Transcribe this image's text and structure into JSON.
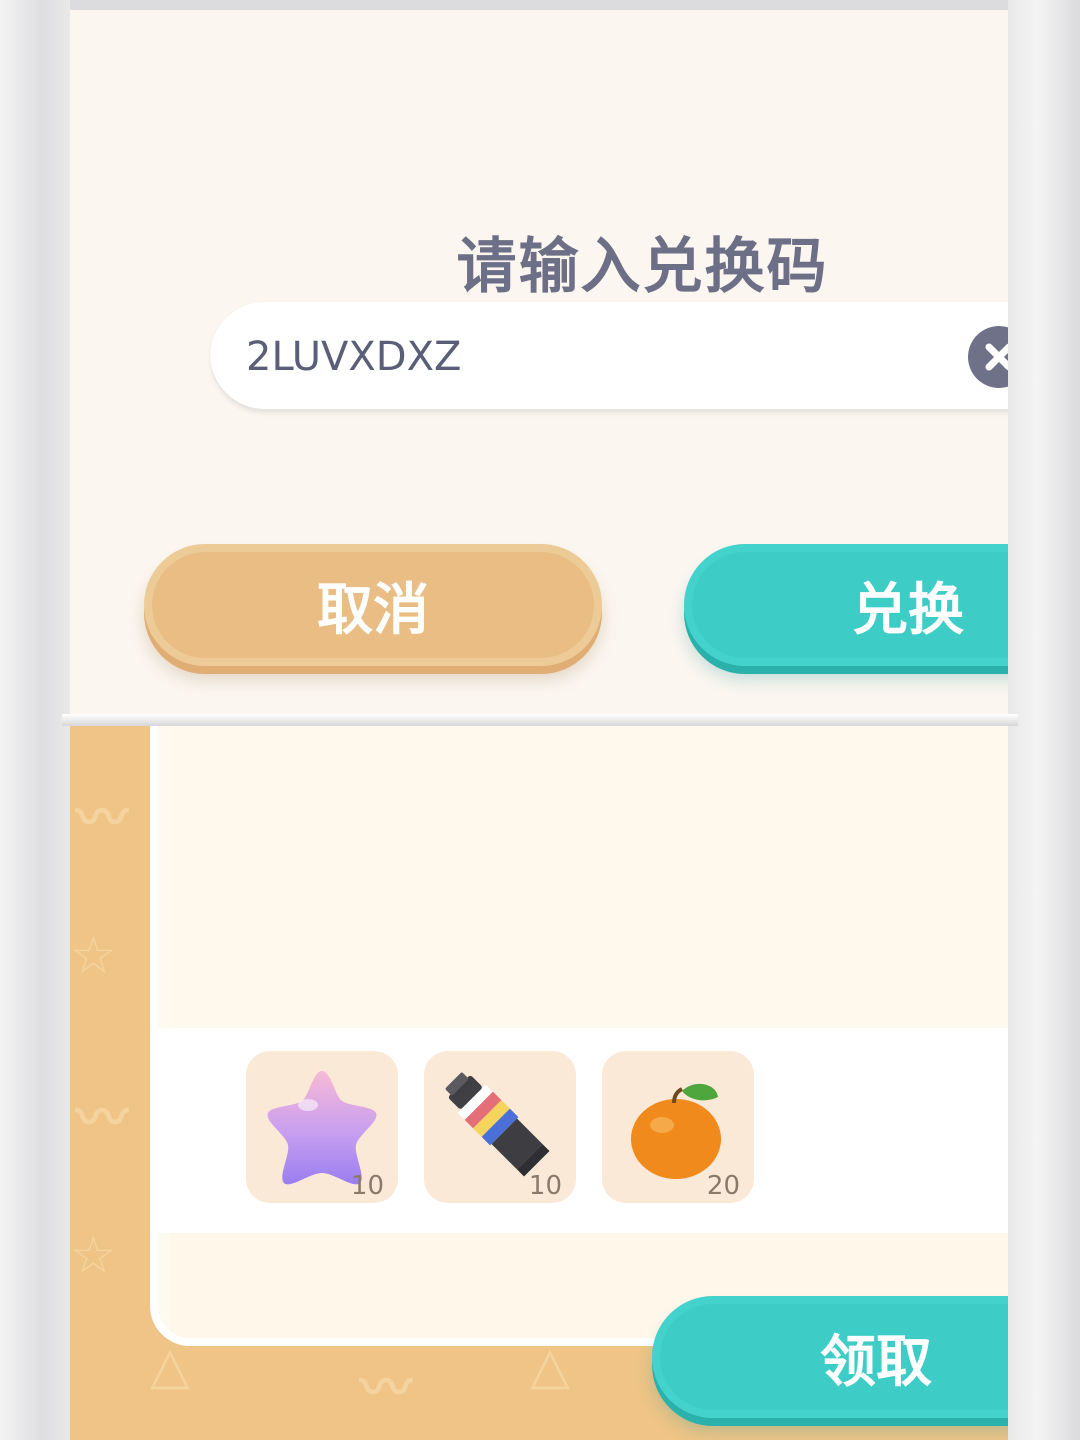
{
  "dialog": {
    "title": "请输入兑换码",
    "input_value": "2LUVXDXZ",
    "cancel_label": "取消",
    "redeem_label": "兑换"
  },
  "rewards": {
    "items": [
      {
        "icon": "star-icon",
        "count": "10"
      },
      {
        "icon": "paint-tube-icon",
        "count": "10"
      },
      {
        "icon": "orange-icon",
        "count": "20"
      }
    ],
    "claim_label": "领取"
  },
  "colors": {
    "accent_teal": "#3ecdc6",
    "cancel_tan": "#e9bd84",
    "title_slate": "#6d6f87",
    "panel_cream": "#fbf6f0"
  }
}
